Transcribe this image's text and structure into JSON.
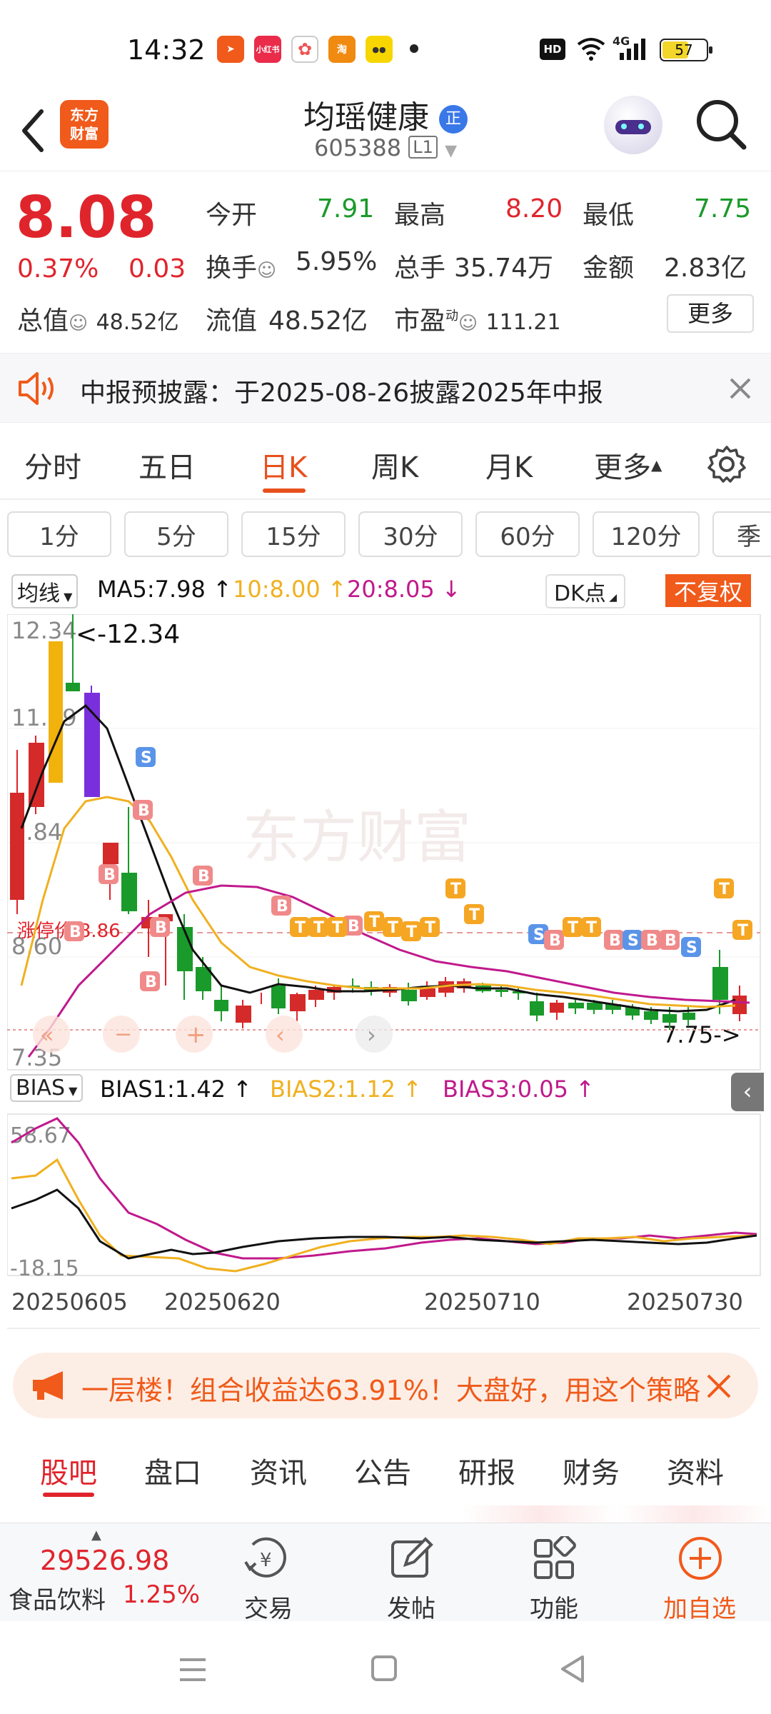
{
  "status_bar": {
    "time": "14:32",
    "app_icons": [
      "send-app",
      "xiaohongshu",
      "photos",
      "taobao",
      "other-app"
    ],
    "network": "4G",
    "battery": "57"
  },
  "header": {
    "logo_line1": "东方",
    "logo_line2": "财富",
    "stock_name": "均瑶健康",
    "badge": "正",
    "stock_code": "605388",
    "level": "L1"
  },
  "quote": {
    "price": "8.08",
    "change_pct": "0.37%",
    "change": "0.03",
    "open_label": "今开",
    "open": "7.91",
    "high_label": "最高",
    "high": "8.20",
    "low_label": "最低",
    "low": "7.75",
    "turnover_label": "换手",
    "turnover": "5.95%",
    "volume_label": "总手",
    "volume": "35.74万",
    "amount_label": "金额",
    "amount": "2.83亿",
    "mktcap_label": "总值",
    "mktcap": "48.52亿",
    "float_label": "流值",
    "float": "48.52亿",
    "pe_label": "市盈",
    "pe_sup": "动",
    "pe": "111.21",
    "more": "更多"
  },
  "notice": {
    "text": "中报预披露：于2025-08-26披露2025年中报"
  },
  "period_tabs": [
    "分时",
    "五日",
    "日K",
    "周K",
    "月K",
    "更多"
  ],
  "active_period": "日K",
  "minute_pills": [
    "1分",
    "5分",
    "15分",
    "30分",
    "60分",
    "120分",
    "季"
  ],
  "ma": {
    "label": "均线",
    "ma5": "MA5:7.98",
    "ma10": "10:8.00",
    "ma20": "20:8.05",
    "dk": "DK点",
    "fq": "不复权"
  },
  "kline": {
    "y_labels": [
      "12.34",
      "11.09",
      "9.84",
      "8.60",
      "7.35"
    ],
    "max_marker": "<-12.34",
    "min_marker": "7.75->",
    "limit_label": "涨停价:8.86",
    "watermark": "东方财富"
  },
  "bias": {
    "label": "BIAS",
    "b1": "BIAS1:1.42",
    "b2": "BIAS2:1.12",
    "b3": "BIAS3:0.05",
    "y_top": "58.67",
    "y_bottom": "-18.15"
  },
  "dates": [
    "20250605",
    "20250620",
    "20250710",
    "20250730"
  ],
  "ad": {
    "text": "一层楼！组合收益达63.91%！大盘好，用这个策略"
  },
  "bottom_tabs": [
    "股吧",
    "盘口",
    "资讯",
    "公告",
    "研报",
    "财务",
    "资料"
  ],
  "active_bottom": "股吧",
  "index": {
    "value": "29526.98",
    "name": "食品饮料",
    "pct": "1.25%"
  },
  "toolbar": {
    "trade": "交易",
    "post": "发帖",
    "func": "功能",
    "add": "加自选"
  },
  "colors": {
    "up": "#e0242c",
    "down": "#1a9a2a",
    "accent": "#e8501c",
    "ma5": "#111111",
    "ma10": "#f0b020",
    "ma20": "#c0198c"
  }
}
